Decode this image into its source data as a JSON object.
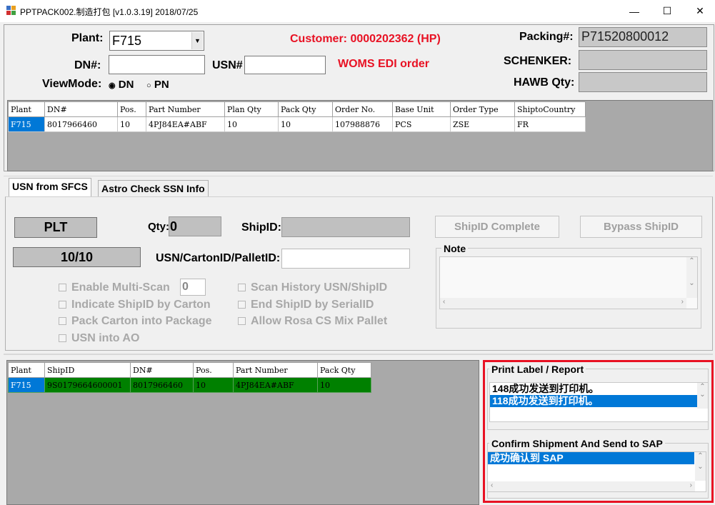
{
  "window": {
    "title": "PPTPACK002.制造打包 [v1.0.3.19] 2018/07/25",
    "minimize": "—",
    "maximize": "☐",
    "close": "✕"
  },
  "header": {
    "plant_label": "Plant:",
    "plant_value": "F715",
    "customer": "Customer: 0000202362 (HP)",
    "dn_label": "DN#:",
    "usn_label": "USN#",
    "order_type": "WOMS EDI order",
    "viewmode_label": "ViewMode:",
    "viewmode_dn": "DN",
    "viewmode_pn": "PN",
    "packing_label": "Packing#:",
    "packing_value": "P71520800012",
    "schenker_label": "SCHENKER:",
    "hawb_label": "HAWB Qty:"
  },
  "top_grid": {
    "columns": [
      "Plant",
      "DN#",
      "Pos.",
      "Part Number",
      "Plan Qty",
      "Pack Qty",
      "Order No.",
      "Base Unit",
      "Order Type",
      "ShiptoCountry"
    ],
    "rows": [
      [
        "F715",
        "8017966460",
        "10",
        "4PJ84EA#ABF",
        "10",
        "10",
        "107988876",
        "PCS",
        "ZSE",
        "FR"
      ]
    ]
  },
  "tabs": [
    "USN from SFCS",
    "Astro Check SSN Info"
  ],
  "scan": {
    "plt": "PLT",
    "count": "10/10",
    "qty_label": "Qty:",
    "qty_value": "0",
    "shipid_label": "ShipID:",
    "usn_label": "USN/CartonID/PalletID:",
    "multiscan_value": "0"
  },
  "checkboxes_left": [
    "Enable Multi-Scan",
    "Indicate ShipID by Carton",
    "Pack Carton into Package",
    "USN into AO"
  ],
  "checkboxes_right": [
    "Scan History USN/ShipID",
    "End ShipID by SerialID",
    "Allow Rosa CS Mix Pallet"
  ],
  "buttons": {
    "shipid_complete": "ShipID Complete",
    "bypass_shipid": "Bypass ShipID"
  },
  "note_label": "Note",
  "bottom_grid": {
    "columns": [
      "Plant",
      "ShipID",
      "DN#",
      "Pos.",
      "Part Number",
      "Pack Qty"
    ],
    "rows": [
      [
        "F715",
        "9S0179664600001",
        "8017966460",
        "10",
        "4PJ84EA#ABF",
        "10"
      ]
    ]
  },
  "print_panel": {
    "title": "Print Label / Report",
    "items": [
      "148成功发送到打印机。",
      "118成功发送到打印机。"
    ]
  },
  "confirm_panel": {
    "title": "Confirm Shipment And Send to SAP",
    "items": [
      "成功确认到 SAP"
    ]
  },
  "colors": {
    "accent_red": "#e81123",
    "selection_blue": "#0078d7",
    "row_green": "#008000"
  }
}
